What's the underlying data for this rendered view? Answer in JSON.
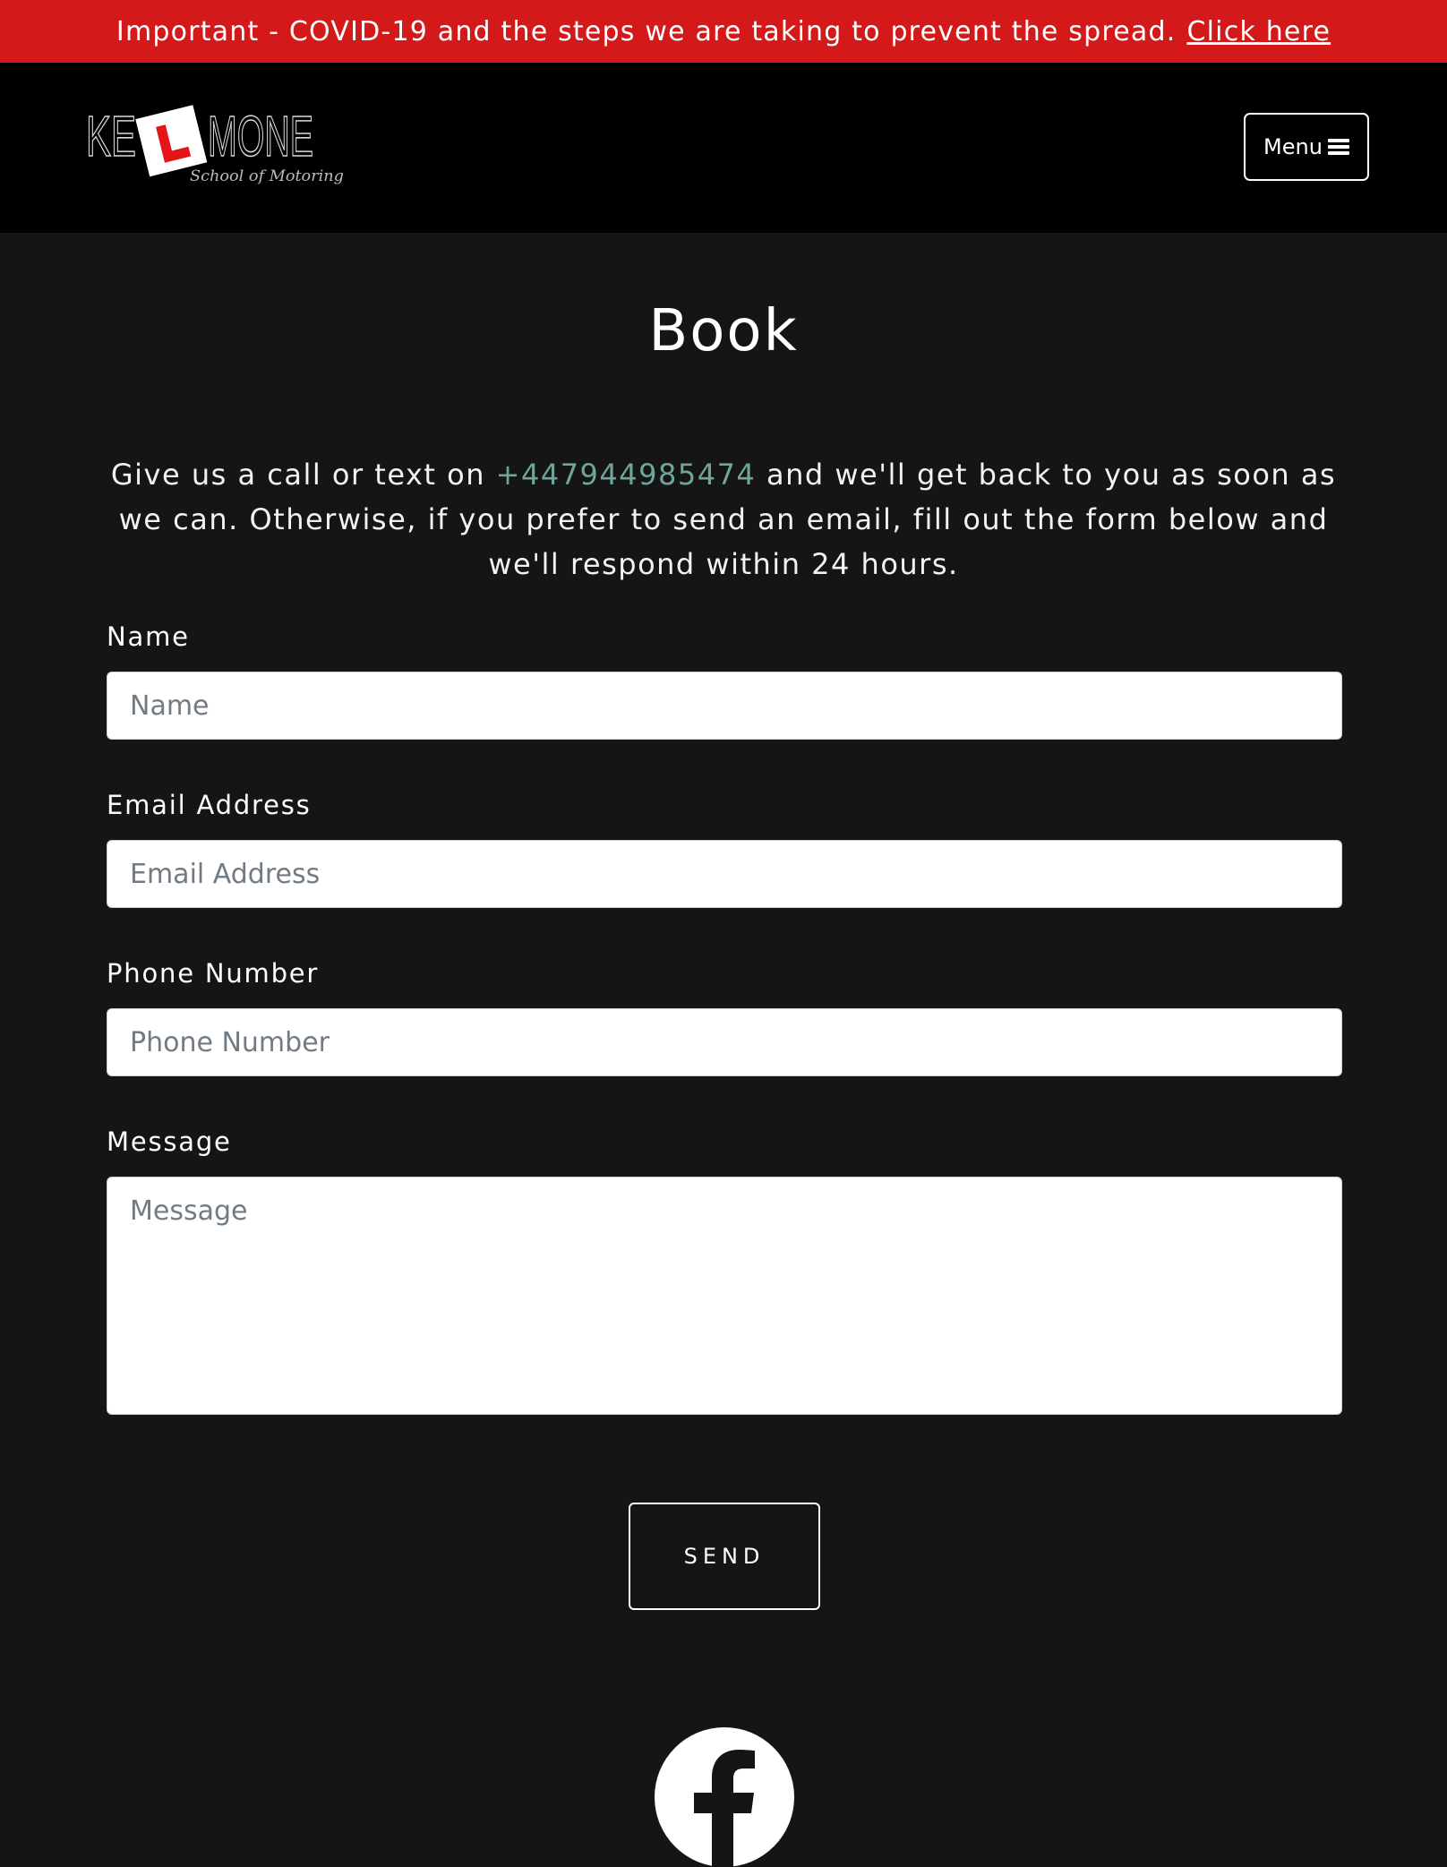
{
  "alert": {
    "text": "Important - COVID-19 and the steps we are taking to prevent the spread.",
    "link_label": "Click here",
    "background_color": "#d4191b"
  },
  "navbar": {
    "logo": {
      "letters_left": "KE",
      "badge_letter": "L",
      "letters_right": "MONE",
      "tagline": "School of Motoring"
    },
    "menu_label": "Menu",
    "menu_icon": "hamburger-icon"
  },
  "main": {
    "title": "Book",
    "intro_before": "Give us a call or text on",
    "phone": "+447944985474",
    "intro_after": "and we'll get back to you as soon as we can. Otherwise, if you prefer to send an email, fill out the form below and we'll respond within 24 hours.",
    "link_color": "#6fa59a"
  },
  "form": {
    "name": {
      "label": "Name",
      "placeholder": "Name",
      "value": ""
    },
    "email": {
      "label": "Email Address",
      "placeholder": "Email Address",
      "value": ""
    },
    "phone": {
      "label": "Phone Number",
      "placeholder": "Phone Number",
      "value": ""
    },
    "message": {
      "label": "Message",
      "placeholder": "Message",
      "value": ""
    },
    "submit_label": "SEND"
  },
  "footer": {
    "social_icon": "facebook-icon"
  }
}
